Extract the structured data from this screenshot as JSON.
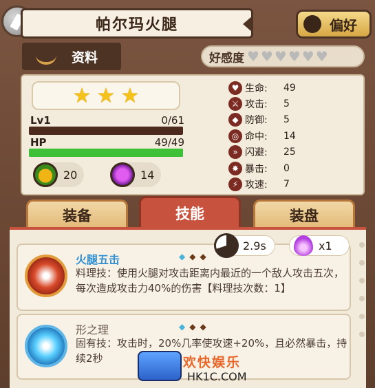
{
  "header": {
    "title": "帕尔玛火腿",
    "favorite_label": "偏好"
  },
  "info_tab": {
    "label": "资料"
  },
  "affinity": {
    "label": "好感度",
    "hearts_filled": 0,
    "hearts_total": 6
  },
  "stars": 3,
  "level": {
    "label": "Lv1",
    "progress_text": "0/61",
    "progress": 0.0
  },
  "hp": {
    "label": "HP",
    "value_text": "49/49",
    "progress": 1.0
  },
  "resources": [
    {
      "icon": "potion-icon",
      "value": "20"
    },
    {
      "icon": "gem-icon",
      "value": "14"
    }
  ],
  "stats": [
    {
      "icon": "heart-icon",
      "label": "生命:",
      "value": "49"
    },
    {
      "icon": "attack-icon",
      "label": "攻击:",
      "value": "5"
    },
    {
      "icon": "shield-icon",
      "label": "防御:",
      "value": "5"
    },
    {
      "icon": "target-icon",
      "label": "命中:",
      "value": "14"
    },
    {
      "icon": "dodge-icon",
      "label": "闪避:",
      "value": "25"
    },
    {
      "icon": "crit-icon",
      "label": "暴击:",
      "value": "0"
    },
    {
      "icon": "speed-icon",
      "label": "攻速:",
      "value": "7"
    }
  ],
  "tabs": [
    {
      "label": "装备",
      "active": false
    },
    {
      "label": "技能",
      "active": true
    },
    {
      "label": "装盘",
      "active": false
    }
  ],
  "cooldown": "2.9s",
  "cost": "x1",
  "skills": [
    {
      "name": "火腿五击",
      "desc": "料理技：使用火腿对攻击距离内最近的一个敌人攻击五次，每次造成攻击力40%的伤害【料理技次数：1】"
    },
    {
      "name": "形之理",
      "desc": "固有技：攻击时，20%几率使攻速+20%，且必然暴击，持续2秒"
    }
  ],
  "watermark": {
    "text": "欢快娱乐",
    "url": "HK1C.COM"
  },
  "colors": {
    "accent_red": "#c7523d",
    "hp_green": "#3ec038",
    "skill_name_blue": "#2f8fd0"
  }
}
